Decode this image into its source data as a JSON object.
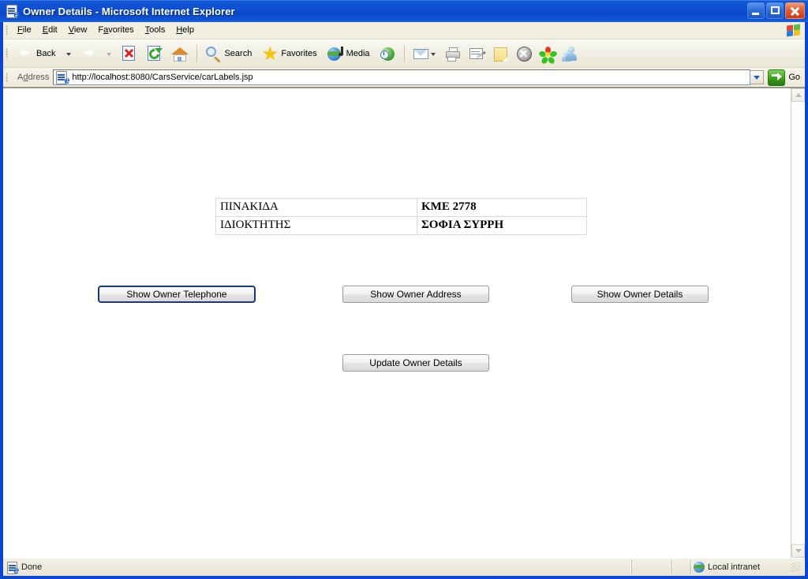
{
  "window": {
    "title": "Owner Details - Microsoft Internet Explorer",
    "icon": "ie-document-icon",
    "controls": {
      "minimize": "Minimize",
      "maximize": "Maximize",
      "close": "Close"
    }
  },
  "menu": {
    "items": [
      {
        "label": "File",
        "accel": "F"
      },
      {
        "label": "Edit",
        "accel": "E"
      },
      {
        "label": "View",
        "accel": "V"
      },
      {
        "label": "Favorites",
        "accel": "a"
      },
      {
        "label": "Tools",
        "accel": "T"
      },
      {
        "label": "Help",
        "accel": "H"
      }
    ],
    "logo": "windows-flag-logo"
  },
  "toolbar": {
    "back_label": "Back",
    "search_label": "Search",
    "favorites_label": "Favorites",
    "media_label": "Media",
    "icons": [
      "back-icon",
      "back-dropdown-icon",
      "forward-icon",
      "forward-dropdown-icon",
      "stop-icon",
      "refresh-icon",
      "home-icon",
      "search-icon",
      "favorites-icon",
      "media-icon",
      "history-icon",
      "mail-icon",
      "mail-dropdown-icon",
      "print-icon",
      "edit-icon",
      "notes-icon",
      "messenger-blocked-icon",
      "icq-icon",
      "msn-messenger-icon"
    ]
  },
  "address": {
    "label": "Address",
    "url": "http://localhost:8080/CarsService/carLabels.jsp",
    "go_label": "Go",
    "favicon": "ie-page-icon",
    "dropdown": "chevron-down-icon"
  },
  "page": {
    "table": {
      "rows": [
        {
          "key": "ΠΙΝΑΚΙΔΑ",
          "value": "ΚΜΕ 2778"
        },
        {
          "key": "ΙΔΙΟΚΤΗΤΗΣ",
          "value": "ΣΟΦΙΑ ΣΥΡΡΗ"
        }
      ]
    },
    "buttons": {
      "show_owner_telephone": "Show Owner Telephone",
      "show_owner_address": "Show Owner Address",
      "show_owner_details": "Show Owner Details",
      "update_owner_details": "Update Owner Details"
    }
  },
  "scrollbar": {
    "up": "scroll-up-arrow",
    "down": "scroll-down-arrow"
  },
  "statusbar": {
    "status": "Done",
    "zone": "Local intranet",
    "status_icon": "ie-page-icon",
    "zone_icon": "intranet-globe-icon"
  },
  "colors": {
    "title_bar_blue": "#0a46d2",
    "chrome_beige": "#f1efe2",
    "focus_ring": "#1b3d6e",
    "page_background": "#ffffff"
  }
}
